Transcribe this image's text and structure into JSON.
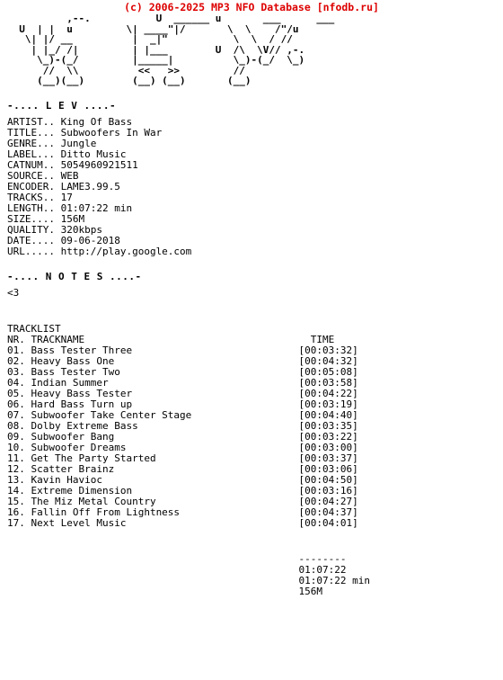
{
  "site_header": "(c) 2006-2025 MP3 NFO Database [nfodb.ru]",
  "accent_color": "#dd0000",
  "text_color": "#000000",
  "background_color": "#ffffff",
  "logo": {
    "name": "lev-ascii-logo",
    "lines": [
      "        ,--.            U ______ u        ___      ___",
      "   U  | |  u         \\| ____\"|/     \\  \\    /\"/u",
      "    \\| |/ __          |  _|\"        \\  \\  / //",
      "     | |_/ /|         | |___         /\\  \\V// ,-.",
      "      \\_)-(_/         |_____|     U  \\_)-(_/  \\_)",
      "           //  \\\\          <<   >>       //      \\\\",
      "          (__)(__)        (__) (__)     (__)"
    ],
    "raw": [
      "          ,--.           U  ______ u       ___      ___",
      "  U  | |  u         \\| ____\"|/       \\  \\    /\"/u",
      "   \\| |/ __          |  _|\"           \\  \\  / //",
      "    | |_/ /|         | |___        U  /\\  \\V// ,-.",
      "     \\_)-(_/         |_____|          \\_)-(_/  \\_)",
      "      //  \\\\          <<   >>         //",
      "     (__)(__)        (__) (__)       (__)"
    ]
  },
  "info_section": {
    "title": "-.... L E V ....-",
    "fields": [
      {
        "label": "ARTIST..",
        "value": "King Of Bass"
      },
      {
        "label": "TITLE...",
        "value": "Subwoofers In War"
      },
      {
        "label": "GENRE...",
        "value": "Jungle"
      },
      {
        "label": "LABEL...",
        "value": "Ditto Music"
      },
      {
        "label": "CATNUM..",
        "value": "5054960921511"
      },
      {
        "label": "SOURCE..",
        "value": "WEB"
      },
      {
        "label": "ENCODER.",
        "value": "LAME3.99.5"
      },
      {
        "label": "TRACKS..",
        "value": "17"
      },
      {
        "label": "LENGTH..",
        "value": "01:07:22 min"
      },
      {
        "label": "SIZE....",
        "value": "156M"
      },
      {
        "label": "QUALITY.",
        "value": "320kbps"
      },
      {
        "label": "DATE....",
        "value": "09-06-2018"
      },
      {
        "label": "URL.....",
        "value": "http://play.google.com"
      }
    ]
  },
  "notes_section": {
    "title": "-.... N O T E S ....-",
    "text": "<3"
  },
  "tracklist_section": {
    "heading": "TRACKLIST",
    "col_nr": "NR.",
    "col_name": "TRACKNAME",
    "col_time": "TIME",
    "tracks": [
      {
        "nr": "01.",
        "name": "Bass Tester Three",
        "time": "[00:03:32]"
      },
      {
        "nr": "02.",
        "name": "Heavy Bass One",
        "time": "[00:04:32]"
      },
      {
        "nr": "03.",
        "name": "Bass Tester Two",
        "time": "[00:05:08]"
      },
      {
        "nr": "04.",
        "name": "Indian Summer",
        "time": "[00:03:58]"
      },
      {
        "nr": "05.",
        "name": "Heavy Bass Tester",
        "time": "[00:04:22]"
      },
      {
        "nr": "06.",
        "name": "Hard Bass Turn up",
        "time": "[00:03:19]"
      },
      {
        "nr": "07.",
        "name": "Subwoofer Take Center Stage",
        "time": "[00:04:40]"
      },
      {
        "nr": "08.",
        "name": "Dolby Extreme Bass",
        "time": "[00:03:35]"
      },
      {
        "nr": "09.",
        "name": "Subwoofer Bang",
        "time": "[00:03:22]"
      },
      {
        "nr": "10.",
        "name": "Subwoofer Dreams",
        "time": "[00:03:00]"
      },
      {
        "nr": "11.",
        "name": "Get The Party Started",
        "time": "[00:03:37]"
      },
      {
        "nr": "12.",
        "name": "Scatter Brainz",
        "time": "[00:03:06]"
      },
      {
        "nr": "13.",
        "name": "Kavin Havioc",
        "time": "[00:04:50]"
      },
      {
        "nr": "14.",
        "name": "Extreme Dimension",
        "time": "[00:03:16]"
      },
      {
        "nr": "15.",
        "name": "The Miz Metal Country",
        "time": "[00:04:27]"
      },
      {
        "nr": "16.",
        "name": "Fallin Off From Lightness",
        "time": "[00:04:37]"
      },
      {
        "nr": "17.",
        "name": "Next Level Music",
        "time": "[00:04:01]"
      }
    ]
  },
  "totals": {
    "separator": "--------",
    "total_time": "01:07:22",
    "total_length": "01:07:22 min",
    "total_size": "156M"
  }
}
